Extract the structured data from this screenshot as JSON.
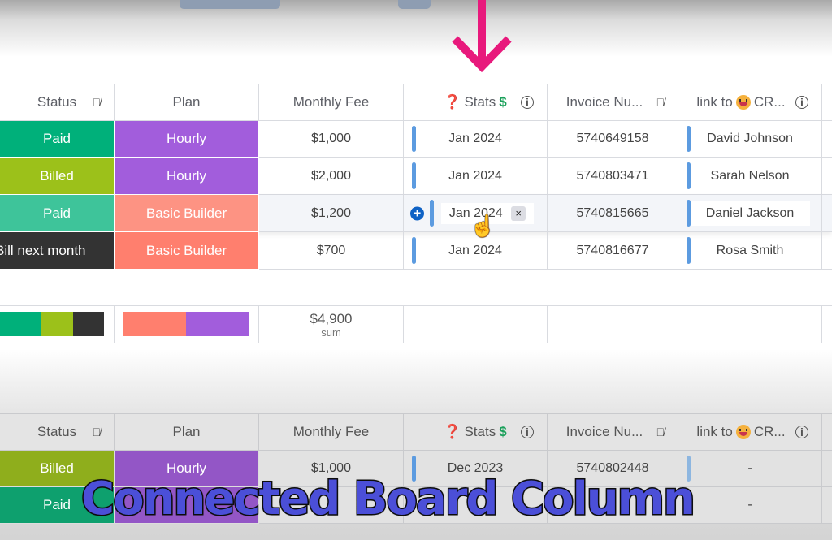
{
  "colors": {
    "accent_arrow": "#e8197c",
    "status_paid": "#00b07a",
    "status_paid_alt": "#3ec49a",
    "status_billed": "#9cc11a",
    "status_bill_next_month": "#333333",
    "plan_hourly": "#a25ddc",
    "plan_basic_builder": "#ff7f6e",
    "link_bar": "#5c9be0"
  },
  "columns": {
    "status": "Status",
    "plan": "Plan",
    "monthly_fee": "Monthly Fee",
    "stats_prefix": "❓",
    "stats": "Stats",
    "stats_suffix": "$",
    "invoice": "Invoice Nu...",
    "link_prefix": "link to",
    "link_suffix": "CR..."
  },
  "icons": {
    "hidden": "eye-slash-icon",
    "info": "info-icon"
  },
  "top_board": {
    "rows": [
      {
        "status": "Paid",
        "plan": "Hourly",
        "fee": "$1,000",
        "stats": "Jan 2024",
        "invoice": "5740649158",
        "contact": "David Johnson"
      },
      {
        "status": "Billed",
        "plan": "Hourly",
        "fee": "$2,000",
        "stats": "Jan 2024",
        "invoice": "5740803471",
        "contact": "Sarah Nelson"
      },
      {
        "status": "Paid",
        "plan": "Basic Builder",
        "fee": "$1,200",
        "stats": "Jan 2024",
        "invoice": "5740815665",
        "contact": "Daniel Jackson"
      },
      {
        "status": "Bill next month",
        "plan": "Basic Builder",
        "fee": "$700",
        "stats": "Jan 2024",
        "invoice": "5740816677",
        "contact": "Rosa Smith"
      }
    ],
    "summary": {
      "fee_sum": "$4,900",
      "fee_sum_label": "sum",
      "status_distribution": [
        {
          "label": "Paid",
          "fraction": 0.5
        },
        {
          "label": "Billed",
          "fraction": 0.25
        },
        {
          "label": "Bill next month",
          "fraction": 0.25
        }
      ],
      "plan_distribution": [
        {
          "label": "Basic Builder",
          "fraction": 0.5
        },
        {
          "label": "Hourly",
          "fraction": 0.5
        }
      ]
    }
  },
  "bottom_board": {
    "rows": [
      {
        "status": "Billed",
        "plan": "Hourly",
        "fee": "$1,000",
        "stats": "Dec 2023",
        "invoice": "5740802448",
        "contact": "-"
      },
      {
        "status": "Paid",
        "plan": "",
        "fee": "",
        "stats": "",
        "invoice": "",
        "contact": "-"
      }
    ]
  },
  "hover_controls": {
    "add": "+",
    "remove": "×"
  },
  "caption": "Connected Board Column"
}
